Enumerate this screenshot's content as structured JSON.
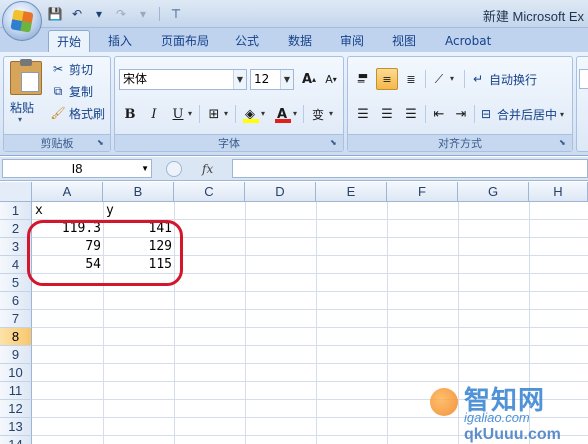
{
  "window": {
    "title": "新建 Microsoft Ex"
  },
  "qat": {
    "save": "💾",
    "undo": "↶",
    "redo": "↷"
  },
  "tabs": [
    {
      "label": "开始",
      "active": true
    },
    {
      "label": "插入"
    },
    {
      "label": "页面布局"
    },
    {
      "label": "公式"
    },
    {
      "label": "数据"
    },
    {
      "label": "审阅"
    },
    {
      "label": "视图"
    },
    {
      "label": "Acrobat"
    }
  ],
  "clipboard": {
    "label": "剪贴板",
    "paste": "粘贴",
    "cut": "剪切",
    "copy": "复制",
    "format_painter": "格式刷"
  },
  "font": {
    "label": "字体",
    "name": "宋体",
    "size": "12",
    "grow": "A",
    "shrink": "A",
    "bold": "B",
    "italic": "I",
    "underline": "U",
    "border": "⊞",
    "fill": "◈",
    "color": "A",
    "phonetic": "变"
  },
  "alignment": {
    "label": "对齐方式",
    "wrap_text": "自动换行",
    "merge_center": "合并后居中"
  },
  "formula_bar": {
    "name_box": "I8",
    "fx": "fx",
    "formula": ""
  },
  "sheet": {
    "columns": [
      "A",
      "B",
      "C",
      "D",
      "E",
      "F",
      "G",
      "H"
    ],
    "rows": [
      "1",
      "2",
      "3",
      "4",
      "5",
      "6",
      "7",
      "8",
      "9",
      "10",
      "11",
      "12",
      "13",
      "14"
    ],
    "selected_row": "8",
    "cells": {
      "A1": "x",
      "B1": "y",
      "A2": "119.3",
      "B2": "141",
      "A3": "79",
      "B3": "129",
      "A4": "54",
      "B4": "115"
    }
  },
  "watermark": {
    "brand": "智知网",
    "url": "igaliao.com",
    "url2": "qkUuuu.com"
  },
  "colors": {
    "highlight": "#d4162c",
    "ribbon": "#dbe7f6",
    "accent": "#15428b"
  }
}
